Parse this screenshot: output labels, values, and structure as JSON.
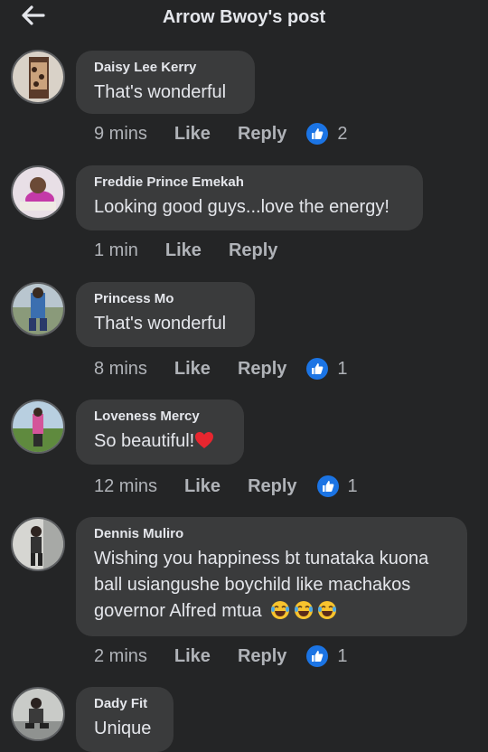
{
  "header": {
    "title": "Arrow Bwoy's post"
  },
  "actions": {
    "like": "Like",
    "reply": "Reply"
  },
  "comments": [
    {
      "name": "Daisy Lee Kerry",
      "text": "That's wonderful",
      "time": "9 mins",
      "reactions": "2"
    },
    {
      "name": "Freddie Prince Emekah",
      "text": "Looking good guys...love the energy!",
      "time": "1 min"
    },
    {
      "name": "Princess Mo",
      "text": "That's wonderful",
      "time": "8 mins",
      "reactions": "1"
    },
    {
      "name": "Loveness Mercy",
      "text": "So beautiful!",
      "time": "12 mins",
      "reactions": "1"
    },
    {
      "name": "Dennis Muliro",
      "lines": [
        "Wishing you happiness bt tunataka kuona",
        "ball usiangushe boychild  like machakos",
        "governor Alfred mtua"
      ],
      "time": "2 mins",
      "reactions": "1"
    },
    {
      "name": "Dady Fit",
      "text": "Unique"
    }
  ],
  "colors": {
    "background": "#242526",
    "bubble": "#3a3b3c",
    "like_blue": "#1b74e4",
    "meta_text": "#b0b3b8"
  }
}
